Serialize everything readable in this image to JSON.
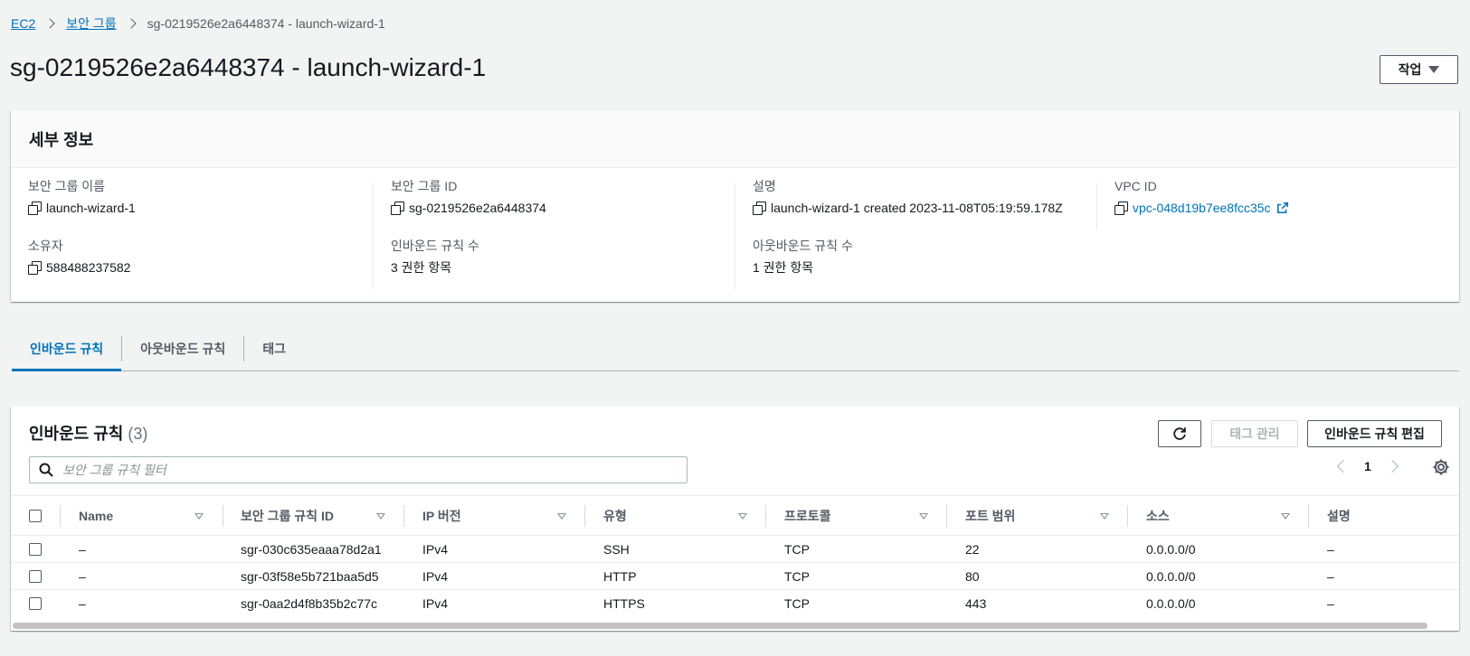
{
  "breadcrumb": {
    "ec2": "EC2",
    "security_groups": "보안 그룹",
    "current": "sg-0219526e2a6448374 - launch-wizard-1"
  },
  "page_title": "sg-0219526e2a6448374 - launch-wizard-1",
  "actions_label": "작업",
  "details": {
    "header": "세부 정보",
    "group_name_label": "보안 그룹 이름",
    "group_name": "launch-wizard-1",
    "group_id_label": "보안 그룹 ID",
    "group_id": "sg-0219526e2a6448374",
    "description_label": "설명",
    "description": "launch-wizard-1 created 2023-11-08T05:19:59.178Z",
    "vpc_label": "VPC ID",
    "vpc_id": "vpc-048d19b7ee8fcc35c",
    "owner_label": "소유자",
    "owner": "588488237582",
    "inbound_count_label": "인바운드 규칙 수",
    "inbound_count": "3 권한 항목",
    "outbound_count_label": "아웃바운드 규칙 수",
    "outbound_count": "1 권한 항목"
  },
  "tabs": [
    "인바운드 규칙",
    "아웃바운드 규칙",
    "태그"
  ],
  "rules": {
    "title": "인바운드 규칙",
    "count": "(3)",
    "manage_tags": "태그 관리",
    "edit_inbound": "인바운드 규칙 편집",
    "search_placeholder": "보안 그룹 규칙 필터",
    "page": "1",
    "columns": [
      "Name",
      "보안 그룹 규칙 ID",
      "IP 버전",
      "유형",
      "프로토콜",
      "포트 범위",
      "소스",
      "설명"
    ],
    "rows": [
      [
        "–",
        "sgr-030c635eaaa78d2a1",
        "IPv4",
        "SSH",
        "TCP",
        "22",
        "0.0.0.0/0",
        "–"
      ],
      [
        "–",
        "sgr-03f58e5b721baa5d5",
        "IPv4",
        "HTTP",
        "TCP",
        "80",
        "0.0.0.0/0",
        "–"
      ],
      [
        "–",
        "sgr-0aa2d4f8b35b2c77c",
        "IPv4",
        "HTTPS",
        "TCP",
        "443",
        "0.0.0.0/0",
        "–"
      ]
    ]
  },
  "colors": {
    "link": "#0073bb",
    "text": "#16191f",
    "muted": "#545b64",
    "background": "#f2f3f3"
  }
}
